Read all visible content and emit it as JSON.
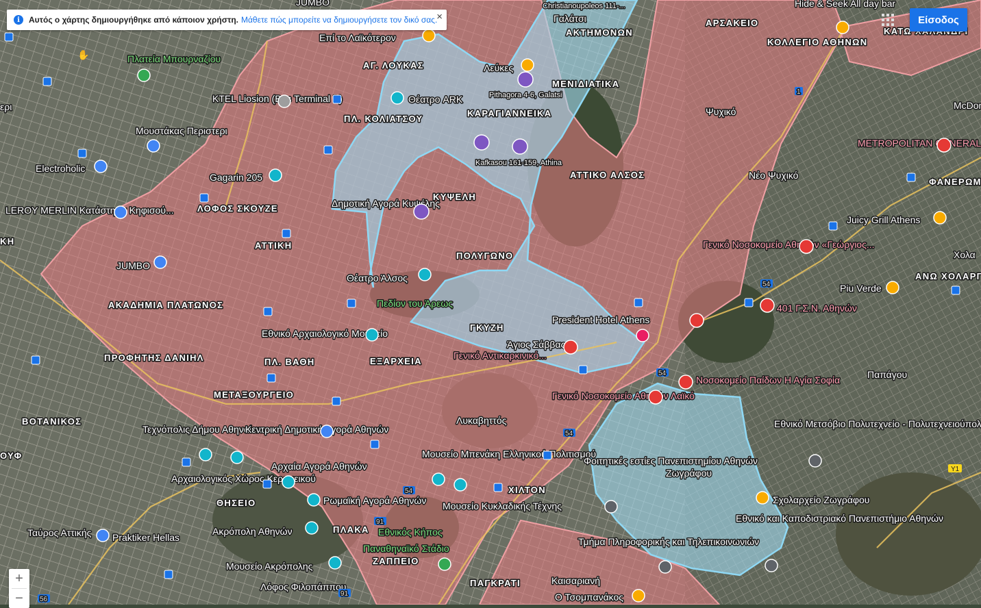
{
  "banner": {
    "info_icon": "info-icon",
    "text": "Αυτός ο χάρτης δημιουργήθηκε από κάποιον χρήστη.",
    "link": "Μάθετε πώς μπορείτε να δημιουργήσετε τον δικό σας.",
    "close": "×"
  },
  "toolbar": {
    "signin_label": "Είσοδος",
    "apps_icon": "apps-grid-icon"
  },
  "zoom": {
    "in": "+",
    "out": "−"
  },
  "layers": {
    "pink_color": "#e07a80",
    "blue_color": "#9fd6ec",
    "pink_border": "#f0a0a4",
    "blue_border": "#8fd8f4"
  },
  "districts": {
    "ag_loukas": "ΑΓ. ΛΟΥΚΑΣ",
    "pl_koliatsou": "ΠΛ. ΚΟΛΙΑΤΣΟΥ",
    "karagianneika": "ΚΑΡΑΓΙΑΝΝΕΙΚΑ",
    "menidiatika": "ΜΕΝΙΔΙΑΤΙΚΑ",
    "akthmonon": "ΑΚΤΗΜΟΝΩΝ",
    "galatsi": "Γαλάτσι",
    "arsakeio": "ΑΡΣΑΚΕΙΟ",
    "kollegio": "ΚΟΛΛΕΓΙΟ ΑΘΗΝΩΝ",
    "kato_chalandri": "ΚΑΤΩ ΧΑΛΑΝΔΡΙ",
    "psychiko": "Ψυχικό",
    "neo_psychiko": "Νέο Ψυχικό",
    "attiko_alsos": "ΑΤΤΙΚΟ ΑΛΣΟΣ",
    "kypseli": "ΚΥΨΕΛΗ",
    "polygono": "ΠΟΛΥΓΩΝΟ",
    "gkyzi": "ΓΚΥΖΗ",
    "lofos_skouze": "ΛΟΦΟΣ ΣΚΟΥΖΕ",
    "attiki": "ΑΤΤΙΚΗ",
    "akadimia_platonos": "ΑΚΑΔΗΜΙΑ ΠΛΑΤΩΝΟΣ",
    "profitis_danil": "ΠΡΟΦΗΤΗΣ ΔΑΝΙΗΛ",
    "pl_vathi": "ΠΛ. ΒΑΘΗ",
    "exarcheia": "ΕΞΑΡΧΕΙΑ",
    "metaxourgeio": "ΜΕΤΑΞΟΥΡΓΕΙΟ",
    "votanikos": "ΒΟΤΑΝΙΚΟΣ",
    "thiseio": "ΘΗΣΕΙΟ",
    "plaka": "ΠΛΑΚΑ",
    "zappeio": "ΖΑΠΠΕΙΟ",
    "chilton": "ΧΙΛΤΟΝ",
    "pagkrati": "ΠΑΓΚΡΑΤΙ",
    "kaisariani": "Καισαριανή",
    "zografou": "Ζωγράφου",
    "papagou": "Παπάγου",
    "ano_cholargos": "ΑΝΩ ΧΟΛΑΡΓ",
    "faneromeni": "ΦΑΝΕΡΩΜ",
    "chol": "Χολα",
    "tavros": "Ταύρος Αττικής",
    "peri": "ερι",
    "kh": "ΚΗ",
    "oyf": "ΟΥΦ"
  },
  "places": {
    "jumbo_top": "JUMBO",
    "epi_to_laikoteron": "Επί το Λαϊκότερον",
    "plateia_mpournaziou": "Πλατεία Μπουρναζίου",
    "ktel": "KTEL Liosion (Bus Terminal B)",
    "moustakas": "Μουστάκας Περιστερι",
    "electroholic": "Electroholic",
    "leroy": "LEROY MERLIN Κατάστημα Κηφισού...",
    "gagarin": "Gagarin 205",
    "jumbo": "JUMBO",
    "theatro_ark": "Θέατρο ARK",
    "leukes": "Λεύκες",
    "pithagora": "Pithagora 4-6, Galatsi",
    "christianoupoleos": "Christianoupoleos 111-...",
    "hide_seek": "Hide & Seek All day bar",
    "kafkasou": "Kafkasou 161-159, Athina",
    "dimotiki_agora": "Δημοτική Αγορά Κυψέλης",
    "theatro_alsos": "Θέατρο Άλσος",
    "pedion_areos": "Πεδίον του Άρεως",
    "ethniko_arch": "Εθνικό Αρχαιολογικό Μουσείο",
    "president": "President Hotel Athens",
    "agios_savvas": "Άγιος Σάββας",
    "antikarkiniko": "Γενικό Αντικαρκινικό...",
    "lykavittos": "Λυκαβηττός",
    "geniko_laiko": "Γενικό Νοσοκομείο Αθηνών Λαϊκό",
    "paidon": "Νοσοκομείο Παίδων Η Αγία Σοφία",
    "georgios": "Γενικό Νοσοκομείο Αθηνών «Γεώργιος...",
    "metropolitan": "METROPOLITAN GENERAL",
    "juicy": "Juicy Grill Athens",
    "piu_verde": "Piu Verde",
    "gsn": "401 Γ.Σ.Ν. Αθηνών",
    "mcdon": "McDon",
    "technopolis": "Τεχνόπολις Δήμου Αθηναίων",
    "kentriki_agora": "Κεντρική Δημοτική Αγορά Αθηνών",
    "archaia_agora": "Αρχαία Αγορά Αθηνών",
    "kerameikos": "Αρχαιολογικός Χώρος Κεραμεικού",
    "romaiki": "Ρωμαϊκή Αγορά Αθηνών",
    "acropolis": "Ακρόπολη Αθηνών",
    "mouseio_akropolis": "Μουσείο Ακρόπολης",
    "praktiker": "Praktiker Hellas",
    "lofos_filopappou": "Λόφος Φιλοπάππου",
    "ethnikos_kipos": "Εθνικός Κήπος",
    "panathinaiko": "Παναθηναϊκό Στάδιο",
    "benaki": "Μουσείο Μπενάκη Ελληνικού Πολιτισμού",
    "kykladikis": "Μουσείο Κυκλαδικής Τέχνης",
    "foititikes": "Φοιτητικές εστίες Πανεπιστημίου Αθηνών",
    "tmima_pliroforikis": "Τμήμα Πληροφορικής και Τηλεπικοινωνιών",
    "kapodistriako": "Εθνικό και Καποδιστριακό Πανεπιστήμιο Αθηνών",
    "scholarcheio": "Σχολαρχείο Ζωγράφου",
    "polytechneio": "Εθνικό Μετσόβιο Πολυτεχνείο - Πολυτεχνειούπολη",
    "tsompanakos": "Ο Τσομπανάκος"
  },
  "roads": {
    "r1": "1",
    "r54": "54",
    "r91": "91",
    "r56": "56",
    "y1": "Υ1"
  }
}
